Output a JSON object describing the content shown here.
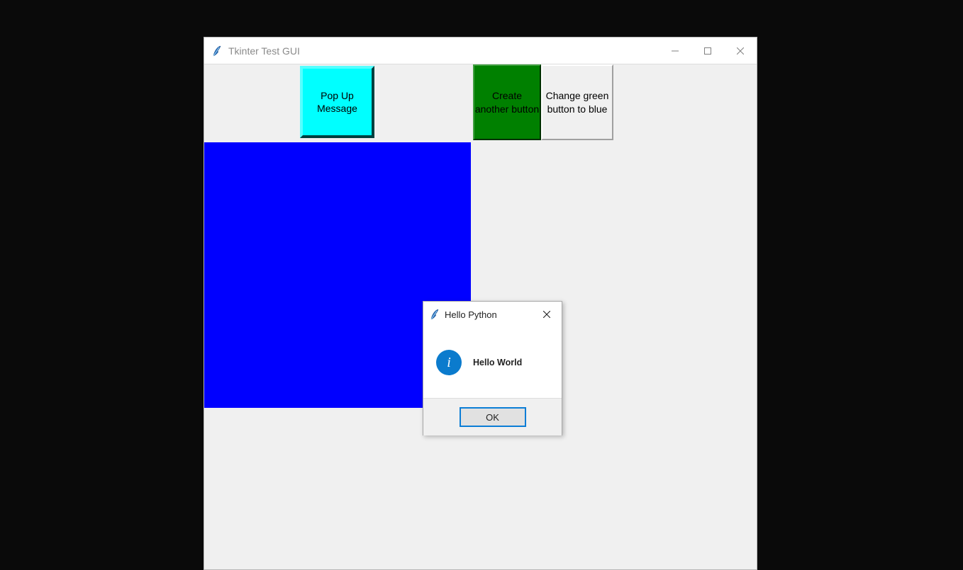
{
  "window": {
    "title": "Tkinter Test GUI",
    "controls": {
      "minimize": "—",
      "maximize": "☐",
      "close": "✕"
    }
  },
  "buttons": {
    "popup": "Pop Up Message",
    "create": "Create another button",
    "change": "Change green button to blue"
  },
  "dialog": {
    "title": "Hello Python",
    "message": "Hello World",
    "ok": "OK",
    "close": "✕",
    "info_glyph": "i"
  },
  "colors": {
    "cyan": "#00ffff",
    "green": "#008000",
    "blue": "#0000ff",
    "info_blue": "#0b7bcd",
    "ok_border": "#0a7dd6"
  }
}
